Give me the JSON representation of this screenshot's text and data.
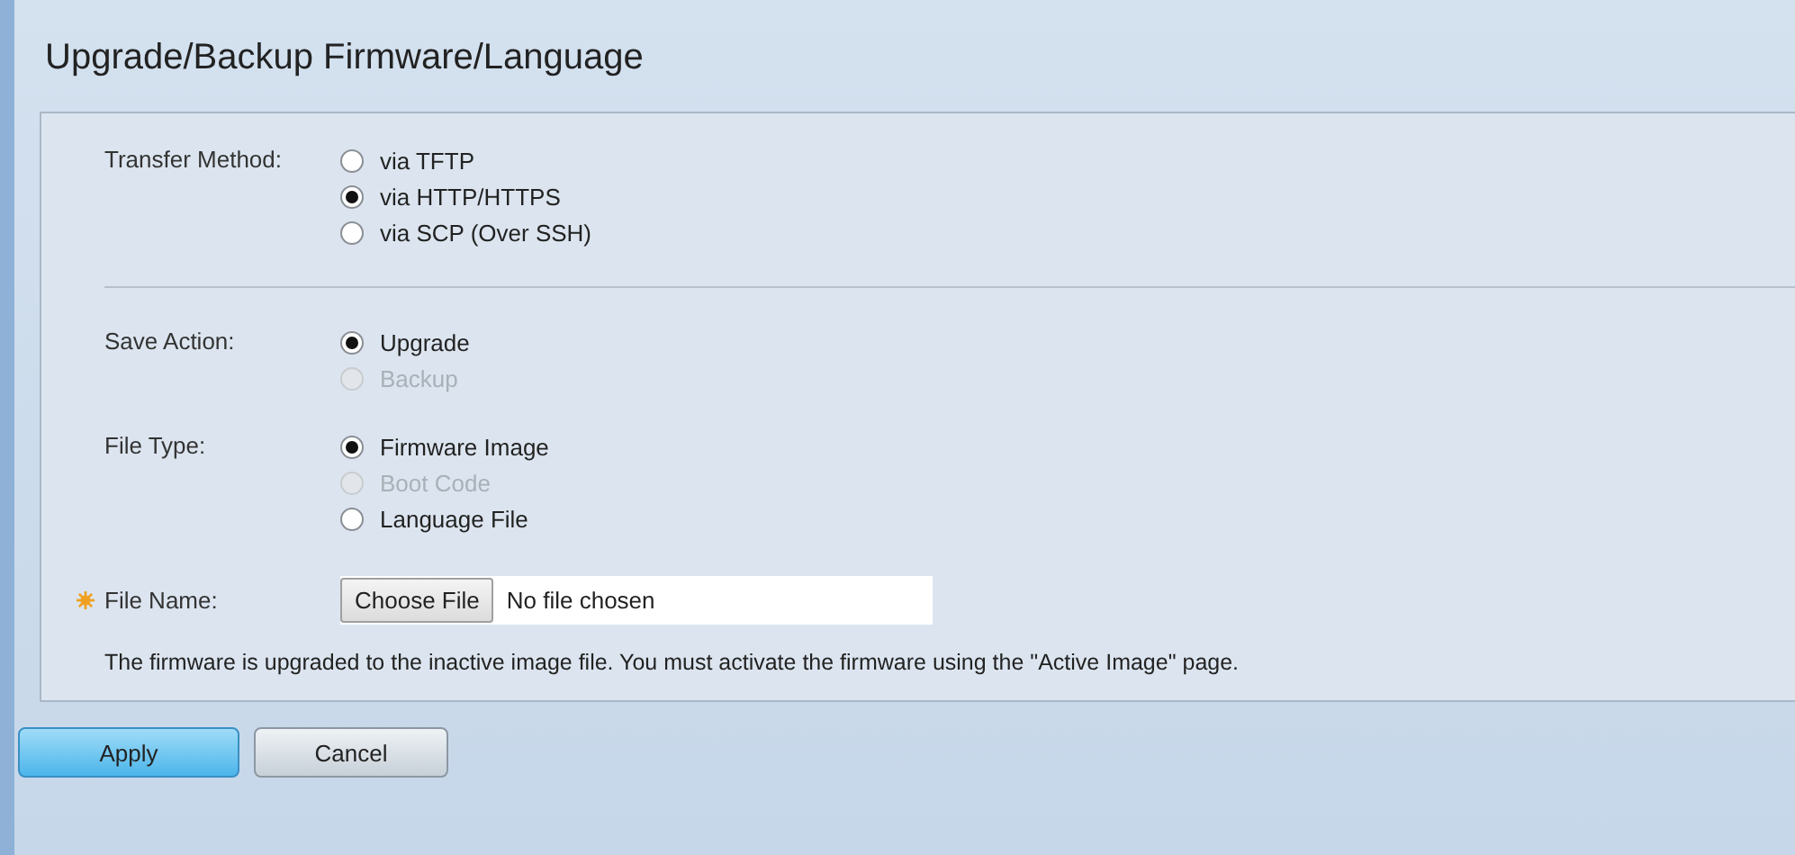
{
  "title": "Upgrade/Backup Firmware/Language",
  "transfer": {
    "label": "Transfer Method:",
    "options": [
      {
        "label": "via TFTP",
        "selected": false,
        "disabled": false
      },
      {
        "label": "via HTTP/HTTPS",
        "selected": true,
        "disabled": false
      },
      {
        "label": "via SCP (Over SSH)",
        "selected": false,
        "disabled": false
      }
    ]
  },
  "groups": [
    {
      "label": "Save Action:",
      "options": [
        {
          "label": "Upgrade",
          "selected": true,
          "disabled": false
        },
        {
          "label": "Backup",
          "selected": false,
          "disabled": true
        }
      ]
    },
    {
      "label": "File Type:",
      "options": [
        {
          "label": "Firmware Image",
          "selected": true,
          "disabled": false
        },
        {
          "label": "Boot Code",
          "selected": false,
          "disabled": true
        },
        {
          "label": "Language File",
          "selected": false,
          "disabled": false
        }
      ]
    }
  ],
  "file_name": {
    "label": "File Name:",
    "required": true,
    "button": "Choose File",
    "status": "No file chosen"
  },
  "note": "The firmware is upgraded to the inactive image file. You must activate the firmware using the \"Active Image\" page.",
  "buttons": [
    {
      "label": "Apply",
      "kind": "primary"
    },
    {
      "label": "Cancel",
      "kind": "secondary"
    }
  ]
}
